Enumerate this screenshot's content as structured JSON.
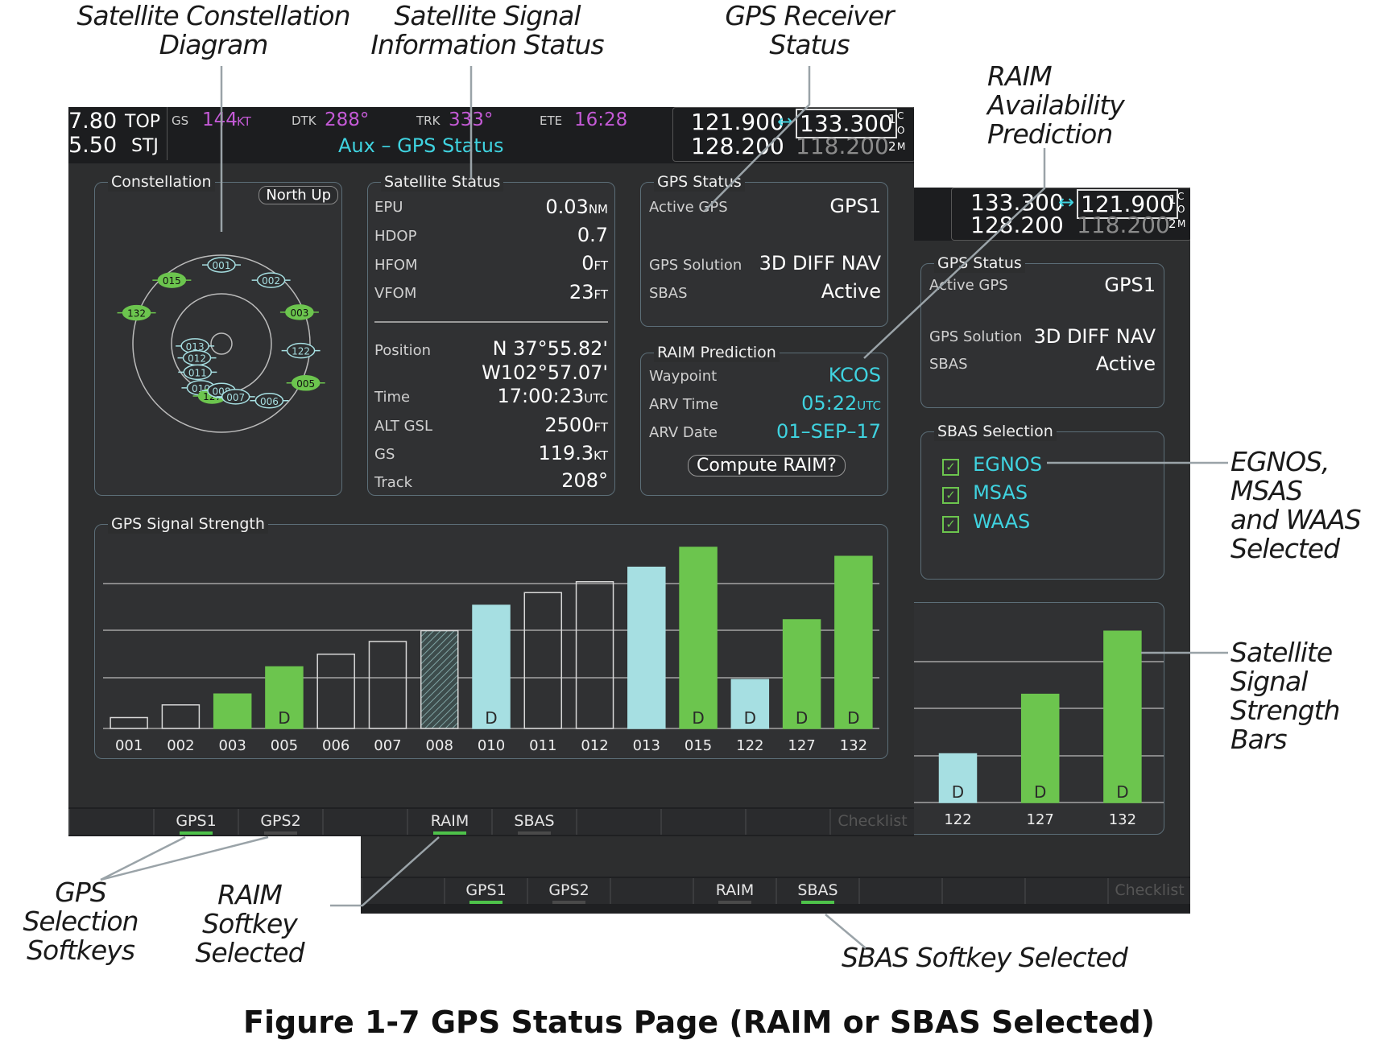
{
  "callouts": {
    "constellation_diagram": [
      "Satellite Constellation",
      "Diagram"
    ],
    "signal_info_status": [
      "Satellite Signal",
      "Information Status"
    ],
    "receiver_status": [
      "GPS Receiver",
      "Status"
    ],
    "raim_prediction": [
      "RAIM",
      "Availability",
      "Prediction"
    ],
    "sbas_selected": [
      "EGNOS, MSAS",
      "and WAAS",
      "Selected"
    ],
    "strength_bars": [
      "Satellite Signal",
      "Strength Bars"
    ],
    "gps_softkeys": [
      "GPS Selection",
      "Softkeys"
    ],
    "raim_softkey": [
      "RAIM Softkey",
      "Selected"
    ],
    "sbas_softkey": "SBAS Softkey Selected"
  },
  "caption": "Figure 1-7 GPS Status Page (RAIM or SBAS Selected)",
  "front": {
    "top": {
      "left_freq_1": "7.80",
      "left_id_1": "TOP",
      "left_freq_2": "5.50",
      "left_id_2": "STJ",
      "gs_label": "GS",
      "gs_value": "144",
      "gs_unit": "KT",
      "dtk_label": "DTK",
      "dtk_value": "288°",
      "trk_label": "TRK",
      "trk_value": "333°",
      "ete_label": "ETE",
      "ete_value": "16:28",
      "page_title": "Aux – GPS Status",
      "com_active": "121.900",
      "com_standby": "133.300",
      "com_2_active": "128.200",
      "com_2_standby": "118.200",
      "com_tag_1": "1",
      "com_tag_2": "2",
      "com_tag_c": "C",
      "com_tag_o": "O",
      "com_tag_m": "M"
    },
    "constellation": {
      "title": "Constellation",
      "orientation_button": "North Up",
      "satellites": [
        {
          "id": "001",
          "color": "cyan"
        },
        {
          "id": "015",
          "color": "green"
        },
        {
          "id": "002",
          "color": "cyan"
        },
        {
          "id": "132",
          "color": "green"
        },
        {
          "id": "003",
          "color": "green"
        },
        {
          "id": "122",
          "color": "cyan"
        },
        {
          "id": "013",
          "color": "cyan"
        },
        {
          "id": "012",
          "color": "cyan"
        },
        {
          "id": "011",
          "color": "cyan"
        },
        {
          "id": "005",
          "color": "green"
        },
        {
          "id": "010",
          "color": "cyan"
        },
        {
          "id": "006",
          "color": "cyan"
        },
        {
          "id": "127",
          "color": "green"
        },
        {
          "id": "008",
          "color": "cyan"
        },
        {
          "id": "007",
          "color": "cyan"
        }
      ]
    },
    "satellite_status": {
      "title": "Satellite Status",
      "epu_label": "EPU",
      "epu_value": "0.03",
      "epu_unit": "NM",
      "hdop_label": "HDOP",
      "hdop_value": "0.7",
      "hfom_label": "HFOM",
      "hfom_value": "0",
      "hfom_unit": "FT",
      "vfom_label": "VFOM",
      "vfom_value": "23",
      "vfom_unit": "FT",
      "position_label": "Position",
      "lat": "N  37°55.82'",
      "lon": "W102°57.07'",
      "time_label": "Time",
      "time_value": "17:00:23",
      "time_unit": "UTC",
      "alt_label": "ALT GSL",
      "alt_value": "2500",
      "alt_unit": "FT",
      "gs_label": "GS",
      "gs_value": "119.3",
      "gs_unit": "KT",
      "track_label": "Track",
      "track_value": "208°"
    },
    "gps_status": {
      "title": "GPS Status",
      "active_label": "Active GPS",
      "active_value": "GPS1",
      "solution_label": "GPS Solution",
      "solution_value": "3D DIFF NAV",
      "sbas_label": "SBAS",
      "sbas_value": "Active"
    },
    "raim": {
      "title": "RAIM Prediction",
      "waypoint_label": "Waypoint",
      "waypoint_value": "KCOS",
      "arv_time_label": "ARV Time",
      "arv_time_value": "05:22",
      "arv_time_unit": "UTC",
      "arv_date_label": "ARV Date",
      "arv_date_value": "01–SEP–17",
      "compute_button": "Compute RAIM?"
    },
    "signal_strength_title": "GPS Signal Strength",
    "softkeys": [
      "",
      "GPS1",
      "GPS2",
      "",
      "RAIM",
      "SBAS",
      "",
      "",
      "",
      "Checklist"
    ]
  },
  "back": {
    "top": {
      "com_active": "133.300",
      "com_standby": "121.900",
      "com_2_active": "128.200",
      "com_2_standby": "118.200",
      "com_tag_1": "1",
      "com_tag_2": "2",
      "com_tag_c": "C",
      "com_tag_o": "O",
      "com_tag_m": "M"
    },
    "gps_status": {
      "title": "GPS Status",
      "active_label": "Active GPS",
      "active_value": "GPS1",
      "solution_label": "GPS Solution",
      "solution_value": "3D DIFF NAV",
      "sbas_label": "SBAS",
      "sbas_value": "Active"
    },
    "sbas_selection": {
      "title": "SBAS Selection",
      "options": [
        {
          "label": "EGNOS",
          "checked": true
        },
        {
          "label": "MSAS",
          "checked": true
        },
        {
          "label": "WAAS",
          "checked": true
        }
      ]
    },
    "softkeys": [
      "",
      "GPS1",
      "GPS2",
      "",
      "RAIM",
      "SBAS",
      "",
      "",
      "",
      "Checklist"
    ]
  },
  "colors": {
    "green": "#6cc54e",
    "cyan": "#a6dfe2",
    "magenta": "#c45ad6",
    "screen_bg": "#2d2e2f",
    "accent_cyan": "#3fd3e0"
  },
  "chart_data": [
    {
      "type": "bar",
      "title": "GPS Signal Strength",
      "categories": [
        "001",
        "002",
        "003",
        "005",
        "006",
        "007",
        "008",
        "010",
        "011",
        "012",
        "013",
        "015",
        "122",
        "127",
        "132"
      ],
      "values": [
        0.06,
        0.13,
        0.19,
        0.34,
        0.41,
        0.48,
        0.54,
        0.68,
        0.75,
        0.81,
        0.89,
        1.0,
        0.27,
        0.6,
        0.95
      ],
      "styles": [
        "outline",
        "outline",
        "green",
        "green",
        "outline",
        "outline",
        "hatched",
        "cyan",
        "outline",
        "outline",
        "cyan",
        "green",
        "cyan",
        "green",
        "green"
      ],
      "labels": [
        "",
        "",
        "",
        "D",
        "",
        "",
        "",
        "D",
        "",
        "",
        "",
        "D",
        "D",
        "D",
        "D"
      ],
      "ylim": [
        0,
        1
      ],
      "grid": true
    },
    {
      "type": "bar",
      "title": "",
      "categories": [
        "013",
        "015",
        "122",
        "127",
        "132"
      ],
      "values": [
        0.88,
        1.0,
        0.27,
        0.6,
        0.95
      ],
      "styles": [
        "cyan",
        "green",
        "cyan",
        "green",
        "green"
      ],
      "labels": [
        "",
        "D",
        "D",
        "D",
        "D"
      ],
      "ylim": [
        0,
        1
      ],
      "grid": true
    }
  ]
}
